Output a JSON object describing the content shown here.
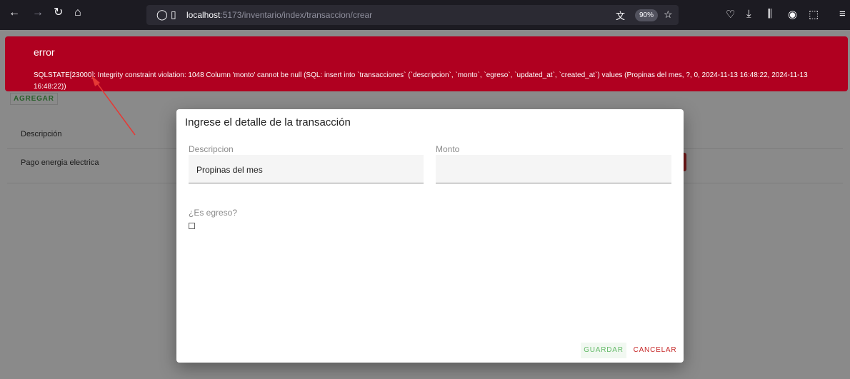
{
  "browser": {
    "url_host": "localhost",
    "url_path": ":5173/inventario/index/transaccion/crear",
    "zoom": "90%"
  },
  "page": {
    "add_button": "AGREGAR",
    "table": {
      "column_header": "Descripción",
      "rows": [
        "Pago energia electrica"
      ]
    }
  },
  "alert": {
    "title": "error",
    "message": "SQLSTATE[23000]: Integrity constraint violation: 1048 Column 'monto' cannot be null (SQL: insert into `transacciones` (`descripcion`, `monto`, `egreso`, `updated_at`, `created_at`) values (Propinas del mes, ?, 0, 2024-11-13 16:48:22, 2024-11-13 16:48:22))"
  },
  "dialog": {
    "title": "Ingrese el detalle de la transacción",
    "descripcion_label": "Descripcion",
    "descripcion_value": "Propinas del mes",
    "monto_label": "Monto",
    "monto_value": "",
    "egreso_label": "¿Es egreso?",
    "egreso_checked": false,
    "save_label": "GUARDAR",
    "cancel_label": "CANCELAR"
  },
  "colors": {
    "alert_bg": "#b00020",
    "save": "#66bb6a",
    "cancel": "#c62828",
    "arrow": "#e53935"
  },
  "icons": [
    "back-icon",
    "forward-icon",
    "reload-icon",
    "home-icon",
    "shield-icon",
    "page-icon",
    "translate-icon",
    "bookmark-star-icon",
    "pocket-icon",
    "download-icon",
    "library-icon",
    "account-icon",
    "extensions-icon",
    "menu-icon"
  ]
}
